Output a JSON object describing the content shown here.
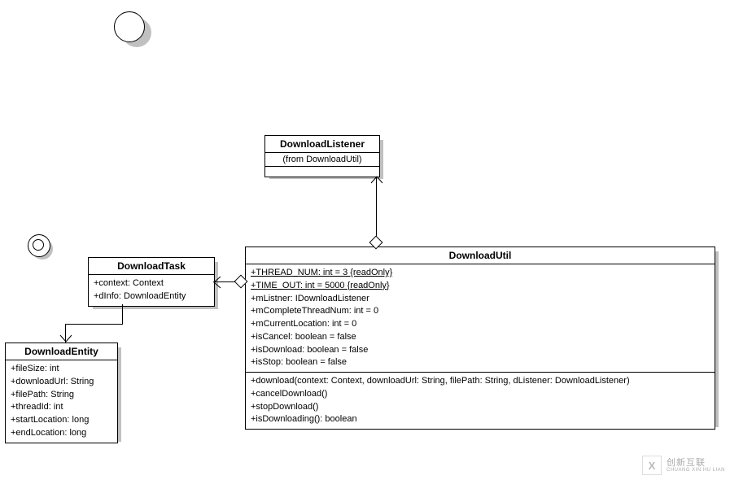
{
  "chart_data": {
    "type": "uml_class_diagram",
    "classes": [
      {
        "name": "DownloadListener",
        "stereotype": "(from DownloadUtil)",
        "attributes": [],
        "operations": []
      },
      {
        "name": "DownloadUtil",
        "attributes": [
          "+THREAD_NUM: int = 3 {readOnly}",
          "+TIME_OUT: int = 5000 {readOnly}",
          "+mListner: IDownloadListener",
          "+mCompleteThreadNum: int = 0",
          "+mCurrentLocation: int = 0",
          "+isCancel: boolean = false",
          "+isDownload: boolean = false",
          "+isStop: boolean = false"
        ],
        "operations": [
          "+download(context: Context, downloadUrl: String, filePath: String, dListener: DownloadListener)",
          "+cancelDownload()",
          "+stopDownload()",
          "+isDownloading(): boolean"
        ]
      },
      {
        "name": "DownloadTask",
        "attributes": [
          "+context: Context",
          "+dInfo: DownloadEntity"
        ],
        "operations": []
      },
      {
        "name": "DownloadEntity",
        "attributes": [
          "+fileSize: int",
          "+downloadUrl: String",
          "+filePath: String",
          "+threadId: int",
          "+startLocation: long",
          "+endLocation: long"
        ],
        "operations": []
      }
    ],
    "relationships": [
      {
        "from": "DownloadUtil",
        "to": "DownloadListener",
        "type": "aggregation"
      },
      {
        "from": "DownloadUtil",
        "to": "DownloadTask",
        "type": "aggregation"
      },
      {
        "from": "DownloadTask",
        "to": "DownloadEntity",
        "type": "association"
      }
    ],
    "state_circles": 2
  },
  "classes": {
    "listener": {
      "name": "DownloadListener",
      "stereotype": "(from DownloadUtil)"
    },
    "util": {
      "name": "DownloadUtil",
      "attrs": [
        "+THREAD_NUM: int = 3 {readOnly}",
        "+TIME_OUT: int = 5000 {readOnly}",
        "+mListner: IDownloadListener",
        "+mCompleteThreadNum: int = 0",
        "+mCurrentLocation: int = 0",
        "+isCancel: boolean = false",
        "+isDownload: boolean = false",
        "+isStop: boolean = false"
      ],
      "ops": [
        "+download(context: Context, downloadUrl: String, filePath: String, dListener: DownloadListener)",
        "+cancelDownload()",
        "+stopDownload()",
        "+isDownloading(): boolean"
      ]
    },
    "task": {
      "name": "DownloadTask",
      "attrs": [
        "+context: Context",
        "+dInfo: DownloadEntity"
      ]
    },
    "entity": {
      "name": "DownloadEntity",
      "attrs": [
        "+fileSize: int",
        "+downloadUrl: String",
        "+filePath: String",
        "+threadId: int",
        "+startLocation: long",
        "+endLocation: long"
      ]
    }
  },
  "watermark": {
    "logo": "X",
    "line1": "创新互联",
    "line2": "CHUANG XIN HU LIAN"
  }
}
